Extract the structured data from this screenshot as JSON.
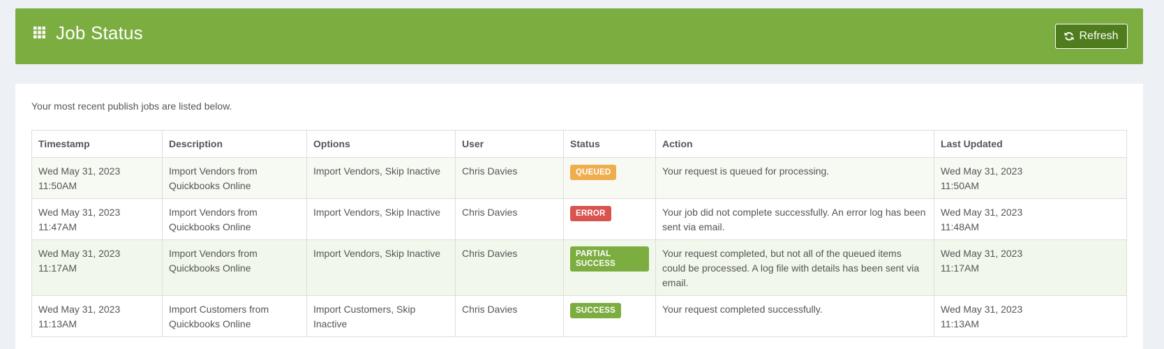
{
  "header": {
    "title": "Job Status",
    "icon": "grid-icon",
    "refresh_label": "Refresh",
    "refresh_icon": "refresh-icon",
    "background_color": "#7cad41"
  },
  "intro_text": "Your most recent publish jobs are listed below.",
  "table": {
    "columns": [
      "Timestamp",
      "Description",
      "Options",
      "User",
      "Status",
      "Action",
      "Last Updated"
    ],
    "rows": [
      {
        "timestamp_date": "Wed May 31, 2023",
        "timestamp_time": "11:50AM",
        "description": "Import Vendors from Quickbooks Online",
        "options": "Import Vendors, Skip Inactive",
        "user": "Chris Davies",
        "status": "QUEUED",
        "status_color": "#f0ad4e",
        "action": "Your request is queued for processing.",
        "updated_date": "Wed May 31, 2023",
        "updated_time": "11:50AM"
      },
      {
        "timestamp_date": "Wed May 31, 2023",
        "timestamp_time": "11:47AM",
        "description": "Import Vendors from Quickbooks Online",
        "options": "Import Vendors, Skip Inactive",
        "user": "Chris Davies",
        "status": "ERROR",
        "status_color": "#d9534f",
        "action": "Your job did not complete successfully. An error log has been sent via email.",
        "updated_date": "Wed May 31, 2023",
        "updated_time": "11:48AM"
      },
      {
        "timestamp_date": "Wed May 31, 2023",
        "timestamp_time": "11:17AM",
        "description": "Import Vendors from Quickbooks Online",
        "options": "Import Vendors, Skip Inactive",
        "user": "Chris Davies",
        "status": "PARTIAL SUCCESS",
        "status_color": "#7cad41",
        "action": "Your request completed, but not all of the queued items could be processed. A log file with details has been sent via email.",
        "updated_date": "Wed May 31, 2023",
        "updated_time": "11:17AM"
      },
      {
        "timestamp_date": "Wed May 31, 2023",
        "timestamp_time": "11:13AM",
        "description": "Import Customers from Quickbooks Online",
        "options": "Import Customers, Skip Inactive",
        "user": "Chris Davies",
        "status": "SUCCESS",
        "status_color": "#7cad41",
        "action": "Your request completed successfully.",
        "updated_date": "Wed May 31, 2023",
        "updated_time": "11:13AM"
      }
    ]
  }
}
